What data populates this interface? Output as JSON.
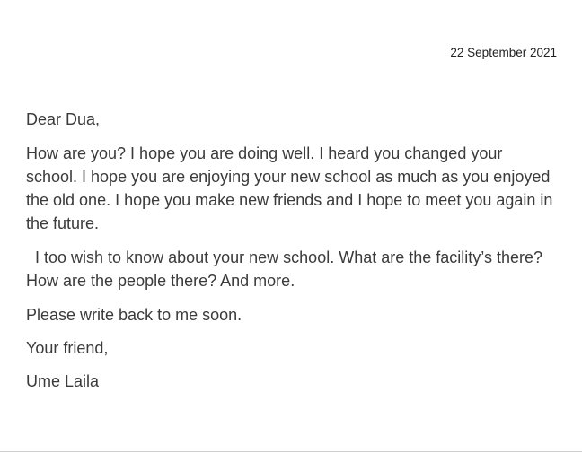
{
  "letter": {
    "date": "22 September 2021",
    "salutation": "Dear Dua,",
    "paragraph_1": "How are you? I hope you are doing well. I heard you changed your school. I hope you are enjoying your new school as much as you enjoyed the old one. I hope you make new friends and I hope to meet you again in the future.",
    "paragraph_2": "  I too wish to know about your new school. What are the facility’s there? How are the people there? And more.",
    "paragraph_3": "Please write back to me soon.",
    "closing": "Your friend,",
    "signature": "Ume Laila"
  }
}
